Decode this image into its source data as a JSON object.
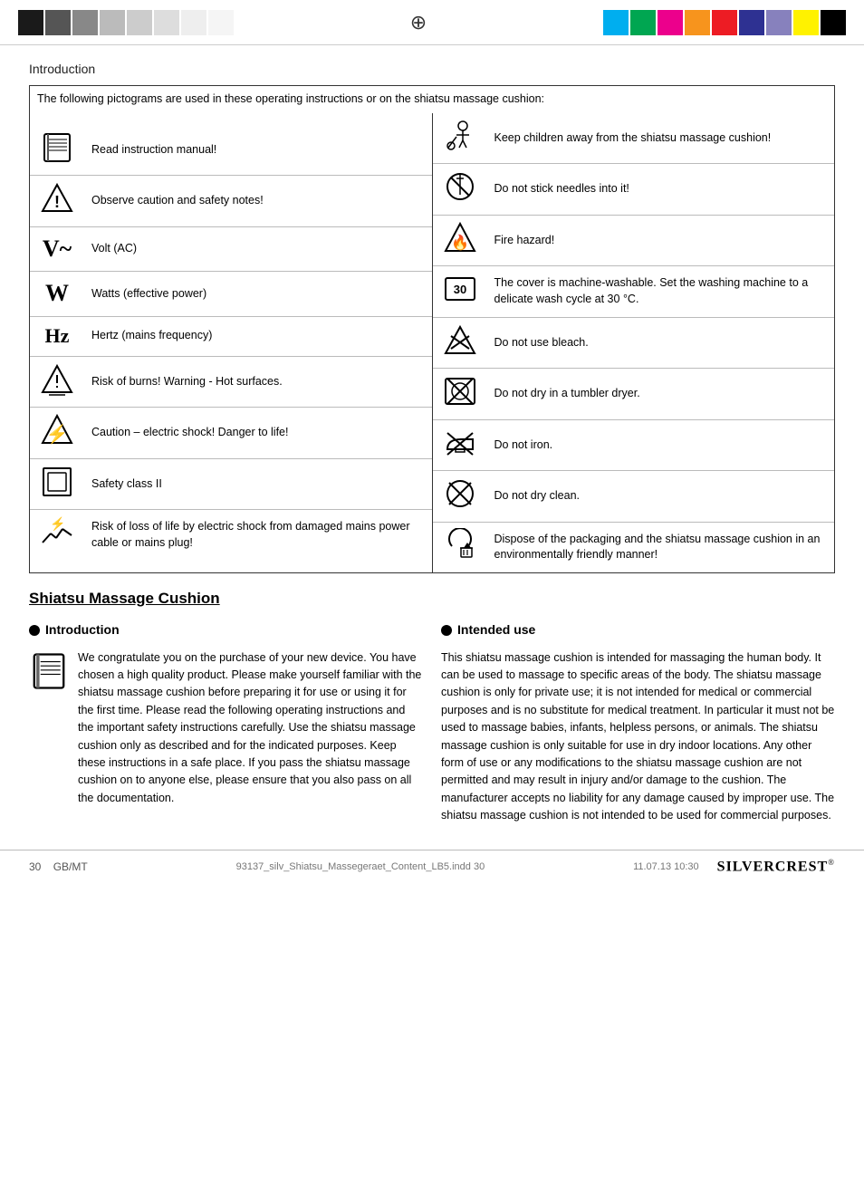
{
  "topBar": {
    "colorBlocksLeft": [
      "#1a1a1a",
      "#444",
      "#888",
      "#bbb",
      "#ddd",
      "#eee",
      "#f5f5f5",
      "#fff"
    ],
    "colorBlocksRight": [
      "#00aeef",
      "#00a651",
      "#ec008c",
      "#f7941d",
      "#ed1c24",
      "#2e3192",
      "#8781bd",
      "#ffff00",
      "#000"
    ],
    "registrationMark": "⊕"
  },
  "pageHeading": "Introduction",
  "pictogramHeader": "The following pictograms are used in these operating instructions or on the shiatsu massage cushion:",
  "leftRows": [
    {
      "iconType": "book",
      "text": "Read instruction manual!"
    },
    {
      "iconType": "caution",
      "text": "Observe caution and safety notes!"
    },
    {
      "iconType": "volt",
      "text": "Volt (AC)"
    },
    {
      "iconType": "watt",
      "text": "Watts (effective power)"
    },
    {
      "iconType": "hz",
      "text": "Hertz (mains frequency)"
    },
    {
      "iconType": "burn",
      "text": "Risk of burns! Warning - Hot surfaces."
    },
    {
      "iconType": "electric",
      "text": "Caution – electric shock! Danger to life!"
    },
    {
      "iconType": "safetyclass",
      "text": "Safety class II"
    },
    {
      "iconType": "damaged",
      "text": "Risk of loss of life by electric shock from damaged mains power cable or mains plug!"
    }
  ],
  "rightRows": [
    {
      "iconType": "children",
      "text": "Keep children away from the shiatsu massage cushion!"
    },
    {
      "iconType": "noneedles",
      "text": "Do not stick needles into it!"
    },
    {
      "iconType": "fire",
      "text": "Fire hazard!"
    },
    {
      "iconType": "wash30",
      "text": "The cover is machine-washable. Set the washing machine to a delicate wash cycle at 30 °C."
    },
    {
      "iconType": "nobleach",
      "text": "Do not use bleach."
    },
    {
      "iconType": "nodryer",
      "text": "Do not dry in a tumbler dryer."
    },
    {
      "iconType": "noiron",
      "text": "Do not iron."
    },
    {
      "iconType": "nodryclean",
      "text": "Do not dry clean."
    },
    {
      "iconType": "dispose",
      "text": "Dispose of the packaging and the shiatsu massage cushion in an environmentally friendly manner!"
    }
  ],
  "mainTitle": "Shiatsu Massage Cushion",
  "introSection": {
    "heading": "Introduction",
    "text": "We congratulate you on the purchase of your new device. You have chosen a high quality product. Please make yourself familiar with the shiatsu massage cushion before preparing it for use or using it for the first time. Please read the following operating instructions and the important safety instructions carefully. Use the shiatsu massage cushion only as described and for the indicated purposes. Keep these instructions in a safe place. If you pass the shiatsu massage cushion on to anyone else, please ensure that you also pass on all the documentation."
  },
  "intendedUseSection": {
    "heading": "Intended use",
    "text": "This shiatsu massage cushion is intended for massaging the human body. It can be used to massage to specific areas of the body. The shiatsu massage cushion is only for private use; it is not intended for medical or commercial purposes and is no substitute for medical treatment. In particular it must not be used to massage babies, infants, helpless persons, or animals. The shiatsu massage cushion is only suitable for use in dry indoor locations. Any other form of use or any modifications to the shiatsu massage cushion are not permitted and may result in injury and/or damage to the cushion. The manufacturer accepts no liability for any damage caused by improper use. The shiatsu massage cushion is not intended to be used for commercial purposes."
  },
  "footer": {
    "pageNumber": "30",
    "locale": "GB/MT",
    "fileInfo": "93137_silv_Shiatsu_Massegeraet_Content_LB5.indd  30",
    "dateTime": "11.07.13   10:30",
    "brand": "SILVERCREST",
    "brandMark": "®"
  }
}
